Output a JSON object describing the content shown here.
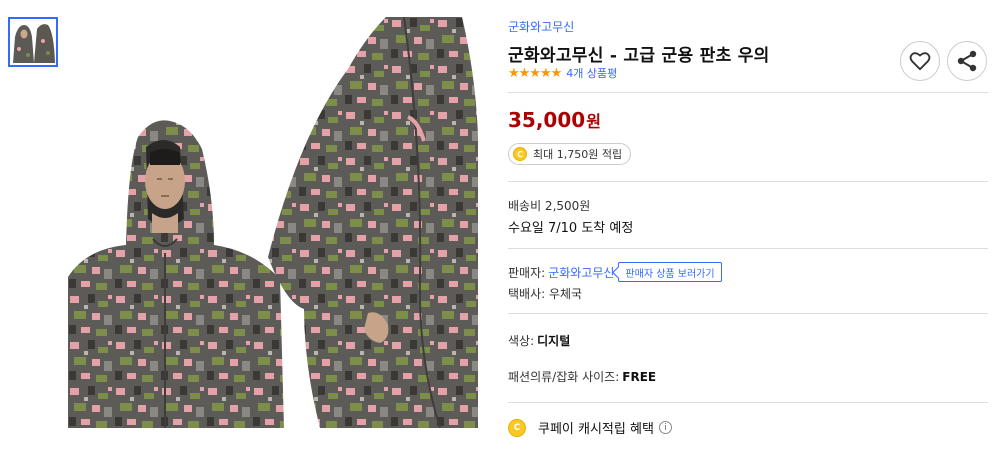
{
  "product": {
    "brand": "군화와고무신",
    "title": "군화와고무신 - 고급 군용 판초 우의",
    "stars": "★★★★★",
    "review_count": "4개 상품평"
  },
  "price": {
    "amount": "35,000",
    "unit": "원"
  },
  "reward": {
    "coin_letter": "C",
    "text": "최대 1,750원 적립"
  },
  "shipping": {
    "fee": "배송비 2,500원",
    "arrival": "수요일 7/10 도착 예정"
  },
  "seller": {
    "label": "판매자:",
    "name": "군화와고무신",
    "link_label": "판매자 상품 보러가기",
    "courier": "택배사: 우체국"
  },
  "options": {
    "color_label": "색상:",
    "color_value": "디지털",
    "size_label": "패션의류/잡화 사이즈:",
    "size_value": "FREE"
  },
  "cash": {
    "coin_letter": "C",
    "text": "쿠페이 캐시적립 혜택",
    "info_glyph": "i"
  },
  "icons": {
    "heart": "heart-icon",
    "share": "share-icon"
  },
  "colors": {
    "accent": "#346aff",
    "price": "#ae0000",
    "star": "#ff9600",
    "coin": "#fcc824"
  }
}
